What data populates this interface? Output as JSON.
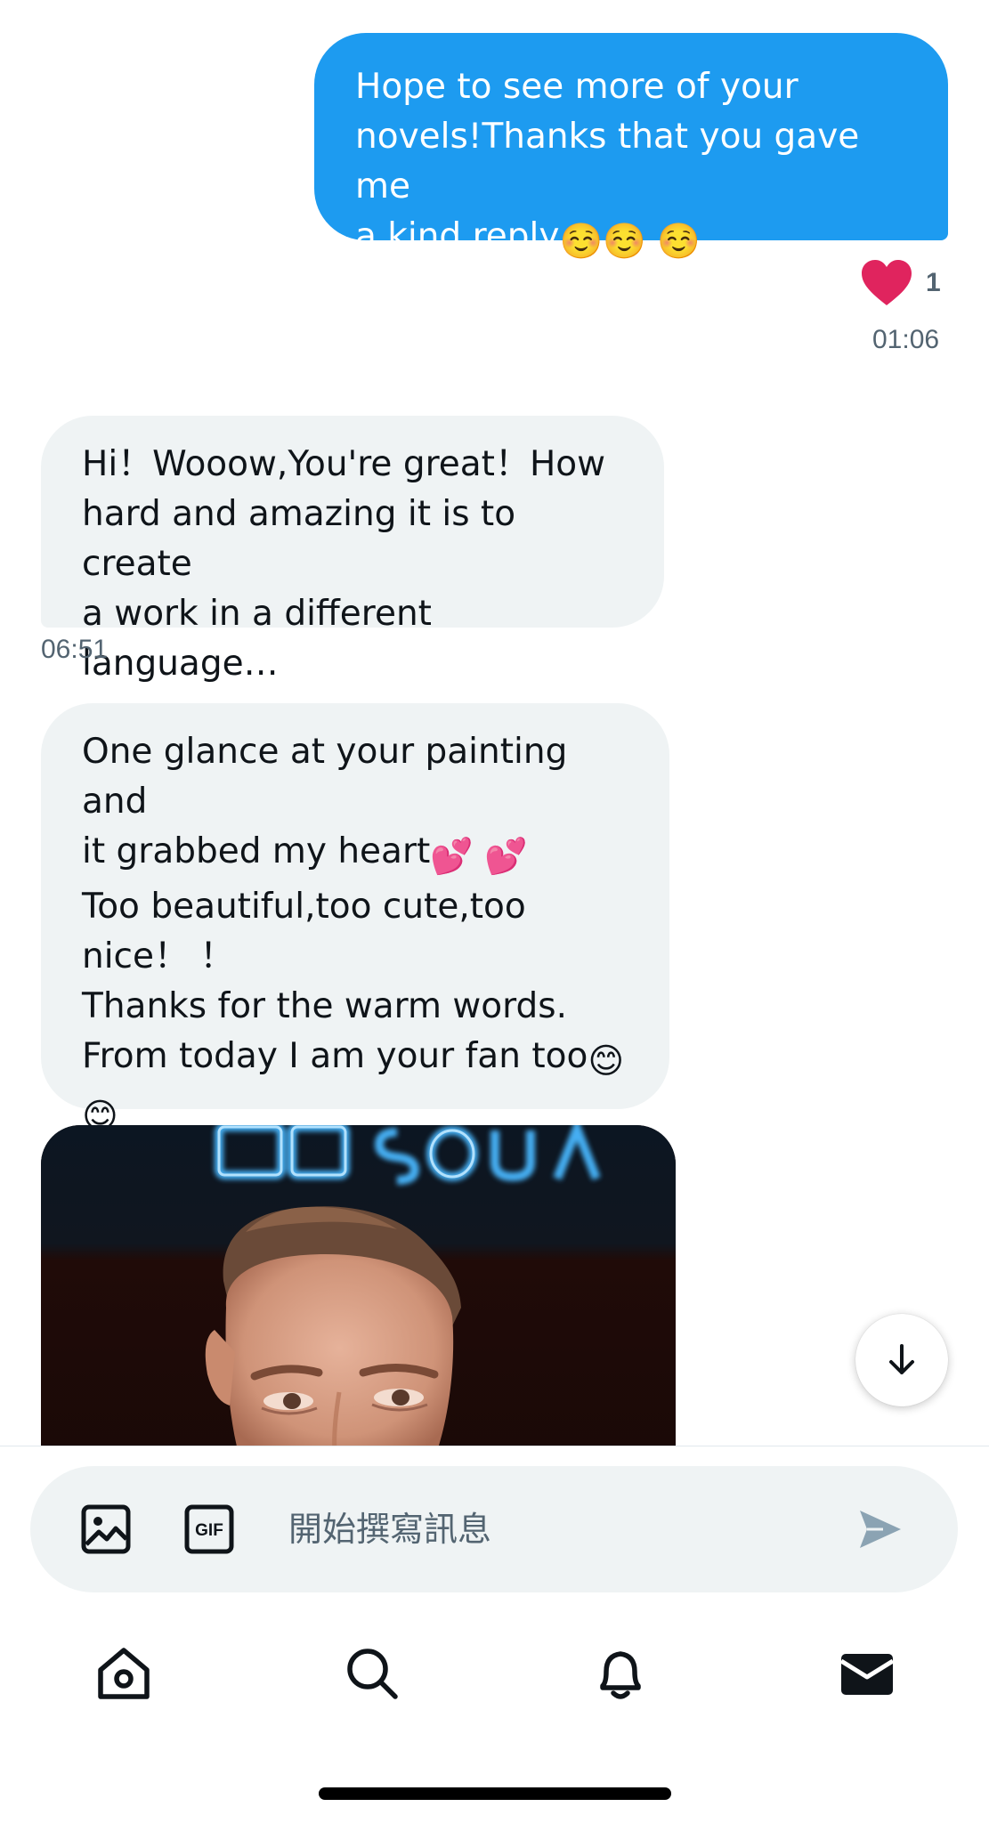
{
  "conversation": {
    "messages": [
      {
        "direction": "outgoing",
        "text": "Hope to see more of your\nnovels!Thanks that you gave me\na kind reply",
        "trailing_emoji": "☺️☺️ ☺️",
        "reaction": {
          "icon": "heart-icon",
          "color": "#f91880",
          "count": "1"
        },
        "time": "01:06"
      },
      {
        "direction": "incoming",
        "text": "Hi！Wooow,You're great！How\nhard and amazing it is to create\na work in a different language…",
        "time": "06:51"
      },
      {
        "direction": "incoming",
        "line1": "One glance at your painting and",
        "line2": "it grabbed my heart",
        "line2_emoji": "💕 💕",
        "line3": "Too beautiful,too cute,too\nnice！ ！\nThanks for the warm words.\nFrom today I am your fan too",
        "line3_emoji": "😊",
        "line4_emoji": "😊"
      },
      {
        "direction": "incoming",
        "attachment": "photo"
      }
    ]
  },
  "composer": {
    "placeholder": "開始撰寫訊息",
    "value": "",
    "media_icon": "image-icon",
    "gif_label": "GIF",
    "send_icon": "send-icon"
  },
  "scroll_button": {
    "icon": "arrow-down-icon"
  },
  "bottom_nav": {
    "items": [
      {
        "icon": "home-icon",
        "active": false
      },
      {
        "icon": "search-icon",
        "active": false
      },
      {
        "icon": "bell-icon",
        "active": false
      },
      {
        "icon": "mail-icon",
        "active": true
      }
    ]
  },
  "colors": {
    "accent": "#1d9bf0",
    "incoming_bubble": "#eff3f4",
    "secondary_text": "#536471",
    "heart": "#f91880"
  }
}
